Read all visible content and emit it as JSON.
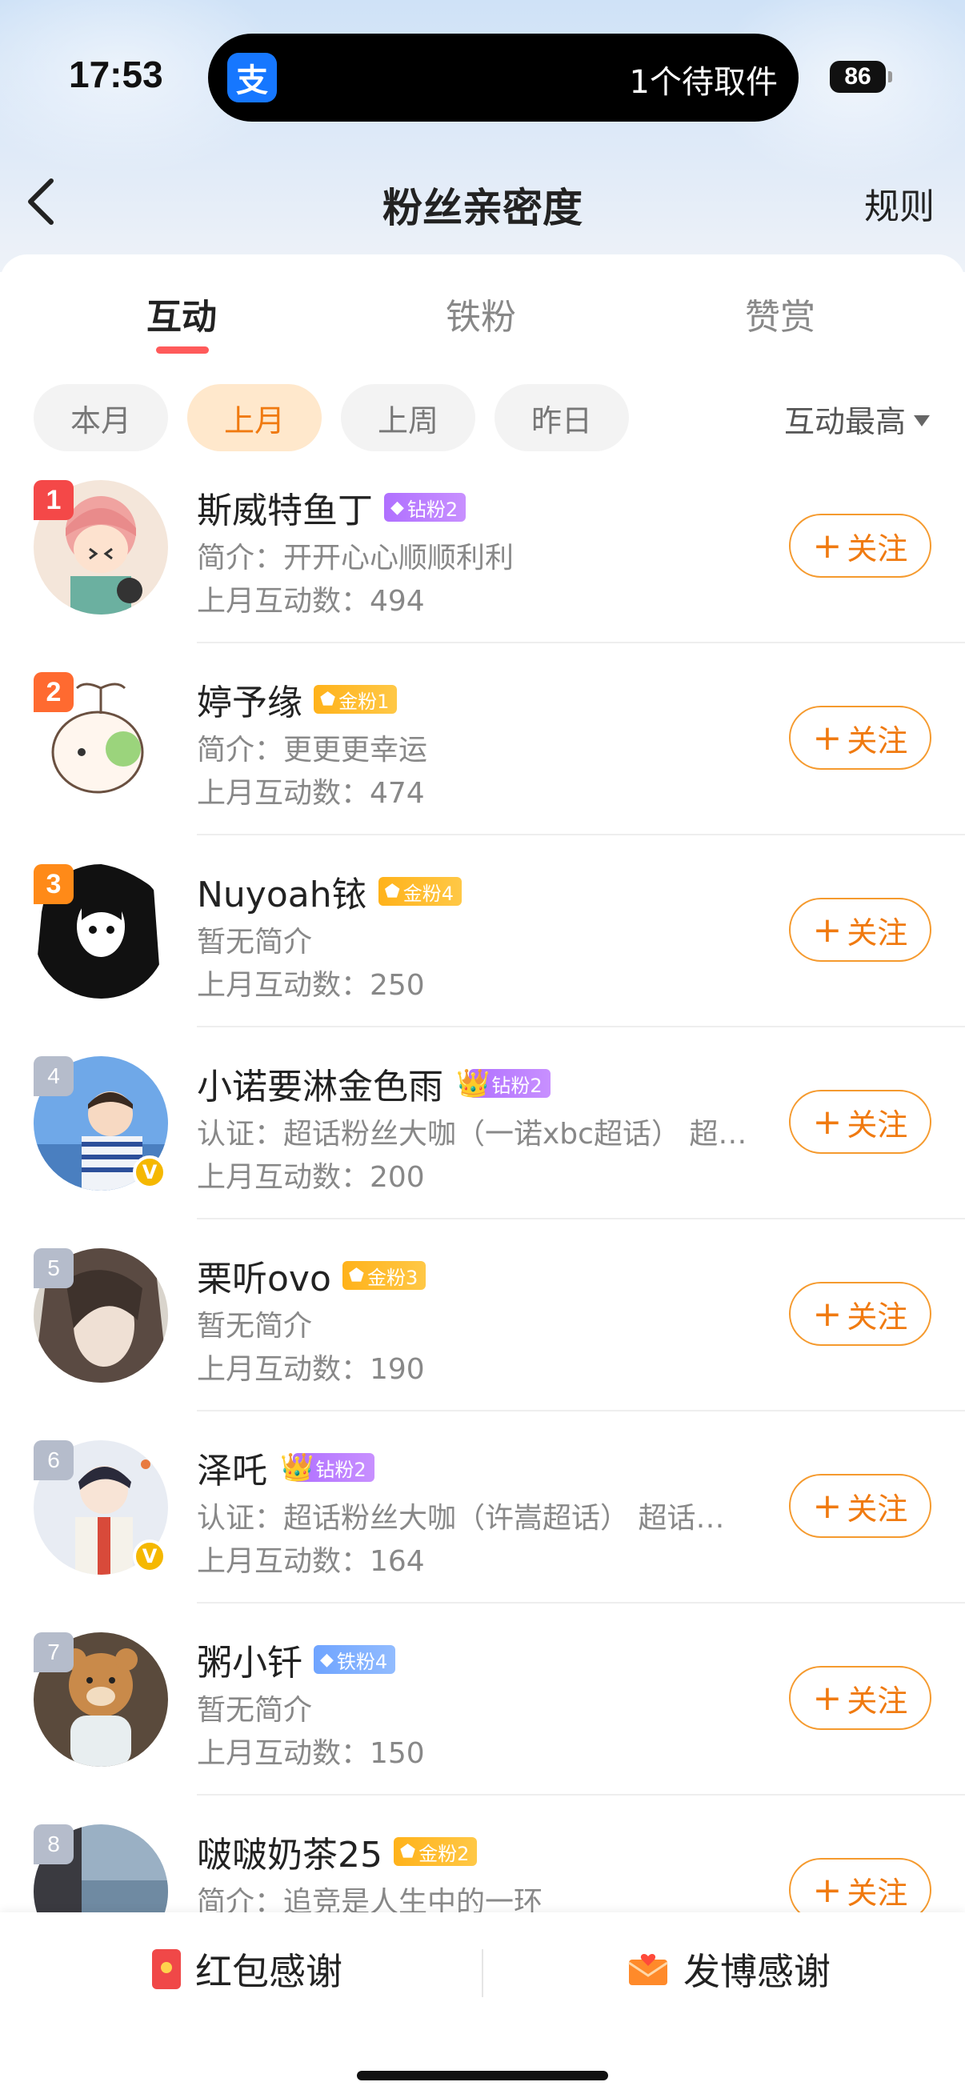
{
  "status_bar": {
    "time": "17:53",
    "island_app_icon": "支",
    "island_text": "1个待取件",
    "battery": "86"
  },
  "nav": {
    "title": "粉丝亲密度",
    "rule": "规则"
  },
  "tabs": [
    {
      "label": "互动",
      "active": true
    },
    {
      "label": "铁粉",
      "active": false
    },
    {
      "label": "赞赏",
      "active": false
    }
  ],
  "filters": [
    {
      "label": "本月",
      "active": false
    },
    {
      "label": "上月",
      "active": true
    },
    {
      "label": "上周",
      "active": false
    },
    {
      "label": "昨日",
      "active": false
    }
  ],
  "sort_label": "互动最高",
  "fans": [
    {
      "rank": "1",
      "name": "斯威特鱼丁",
      "badge": "钻粉2",
      "badge_type": "diamond",
      "bio": "简介：开开心心顺顺利利",
      "count": "上月互动数：494",
      "verified": false,
      "crown": false
    },
    {
      "rank": "2",
      "name": "婷予缘",
      "badge": "金粉1",
      "badge_type": "gold",
      "bio": "简介：更更更幸运",
      "count": "上月互动数：474",
      "verified": false,
      "crown": false
    },
    {
      "rank": "3",
      "name": "Nuyoah铱",
      "badge": "金粉4",
      "badge_type": "gold",
      "bio": "暂无简介",
      "count": "上月互动数：250",
      "verified": false,
      "crown": false
    },
    {
      "rank": "4",
      "name": "小诺要淋金色雨",
      "badge": "钻粉2",
      "badge_type": "diamond",
      "bio": "认证：超话粉丝大咖（一诺xbc超话） 超…",
      "count": "上月互动数：200",
      "verified": true,
      "crown": true
    },
    {
      "rank": "5",
      "name": "栗听ovo",
      "badge": "金粉3",
      "badge_type": "gold",
      "bio": "暂无简介",
      "count": "上月互动数：190",
      "verified": false,
      "crown": false
    },
    {
      "rank": "6",
      "name": "泽吒",
      "badge": "钻粉2",
      "badge_type": "diamond",
      "bio": "认证：超话粉丝大咖（许嵩超话） 超话粉…",
      "count": "上月互动数：164",
      "verified": true,
      "crown": true
    },
    {
      "rank": "7",
      "name": "粥小钎",
      "badge": "铁粉4",
      "badge_type": "iron",
      "bio": "暂无简介",
      "count": "上月互动数：150",
      "verified": false,
      "crown": false
    },
    {
      "rank": "8",
      "name": "啵啵奶茶25",
      "badge": "金粉2",
      "badge_type": "gold",
      "bio": "简介：追竞是人生中的一环",
      "count": "",
      "verified": false,
      "crown": false
    }
  ],
  "follow_label": "关注",
  "follow_plus": "+",
  "bottom": {
    "left_label": "红包感谢",
    "right_label": "发博感谢"
  }
}
